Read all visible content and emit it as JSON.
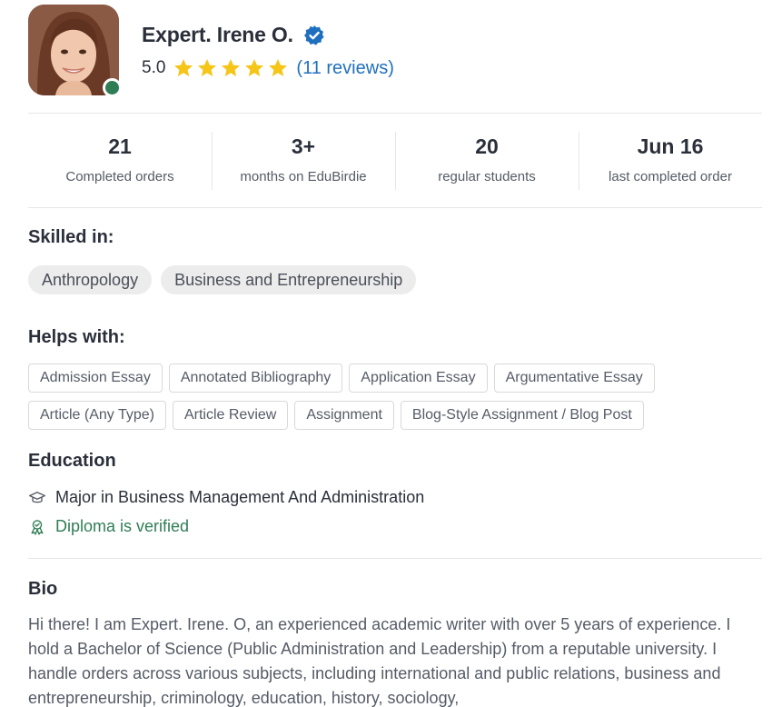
{
  "profile": {
    "name": "Expert. Irene O.",
    "rating": "5.0",
    "stars": 5,
    "reviews_link": "(11 reviews)",
    "online": true
  },
  "stats": [
    {
      "value": "21",
      "label": "Completed orders"
    },
    {
      "value": "3+",
      "label": "months on EduBirdie"
    },
    {
      "value": "20",
      "label": "regular students"
    },
    {
      "value": "Jun 16",
      "label": "last completed order"
    }
  ],
  "skilled_in": {
    "title": "Skilled in:",
    "tags": [
      "Anthropology",
      "Business and Entrepreneurship"
    ]
  },
  "helps_with": {
    "title": "Helps with:",
    "tags": [
      "Admission Essay",
      "Annotated Bibliography",
      "Application Essay",
      "Argumentative Essay",
      "Article (Any Type)",
      "Article Review",
      "Assignment",
      "Blog-Style Assignment / Blog Post"
    ]
  },
  "education": {
    "title": "Education",
    "major": "Major in Business Management And Administration",
    "diploma": "Diploma is verified"
  },
  "bio": {
    "title": "Bio",
    "text": "Hi there! I am Expert. Irene. O, an experienced academic writer with over 5 years of experience. I hold a Bachelor of Science (Public Administration and Leadership) from a reputable university. I handle orders across various subjects, including international and public relations, business and entrepreneurship, criminology, education, history, sociology,"
  },
  "colors": {
    "accent_link": "#1f6fbf",
    "star": "#f5c518",
    "verified_badge": "#1f6fbf",
    "online": "#2f7d55",
    "diploma_verified": "#2f7d55"
  },
  "icons": {
    "verified": "verified-badge-icon",
    "star": "star-icon",
    "major": "graduation-cap-icon",
    "diploma": "award-ribbon-icon"
  }
}
